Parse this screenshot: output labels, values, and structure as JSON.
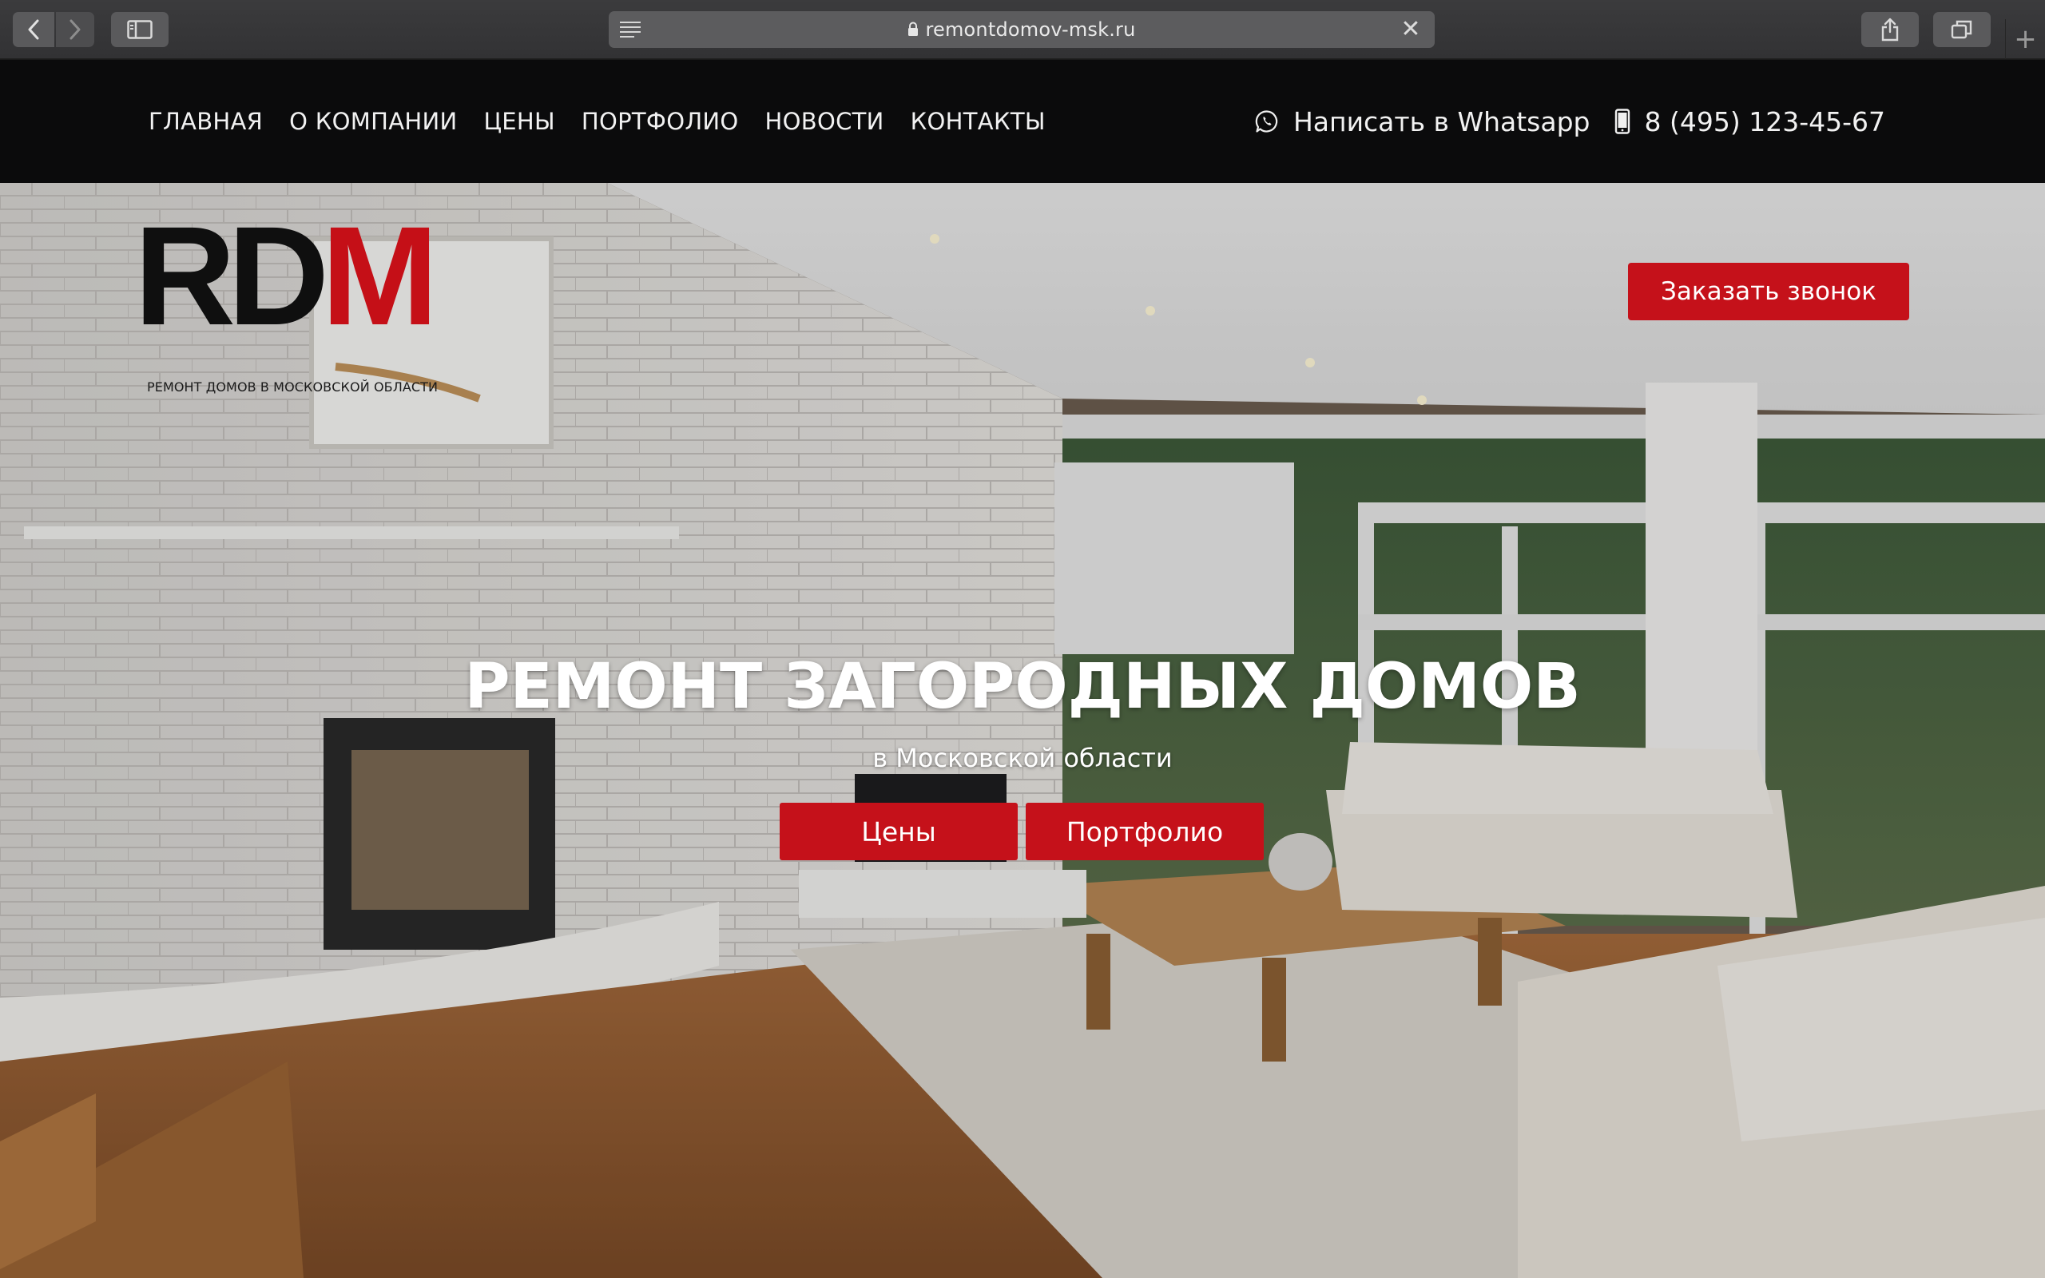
{
  "browser": {
    "url": "remontdomov-msk.ru",
    "new_tab_symbol": "+",
    "close_symbol": "✕"
  },
  "nav": {
    "items": [
      {
        "label": "ГЛАВНАЯ"
      },
      {
        "label": "О КОМПАНИИ"
      },
      {
        "label": "ЦЕНЫ"
      },
      {
        "label": "ПОРТФОЛИО"
      },
      {
        "label": "НОВОСТИ"
      },
      {
        "label": "КОНТАКТЫ"
      }
    ]
  },
  "contacts": {
    "whatsapp_label": "Написать в Whatsapp",
    "phone": "8 (495) 123-45-67"
  },
  "logo": {
    "mark_black": "RD",
    "mark_red": "M",
    "tagline": "РЕМОНТ ДОМОВ В МОСКОВСКОЙ ОБЛАСТИ"
  },
  "hero": {
    "callback_label": "Заказать звонок",
    "title": "РЕМОНТ ЗАГОРОДНЫХ ДОМОВ",
    "subtitle": "в Московской области",
    "prices_label": "Цены",
    "portfolio_label": "Портфолио"
  },
  "colors": {
    "accent": "#c5111a",
    "header_bg": "#0b0b0c",
    "browser_chrome": "#3b3b3d"
  },
  "icons": {
    "back": "chevron-left-icon",
    "forward": "chevron-right-icon",
    "sidebar": "sidebar-icon",
    "reader": "reader-icon",
    "lock": "lock-icon",
    "close": "close-icon",
    "share": "share-icon",
    "tabs": "tabs-icon",
    "whatsapp": "whatsapp-icon",
    "phone": "phone-icon"
  }
}
